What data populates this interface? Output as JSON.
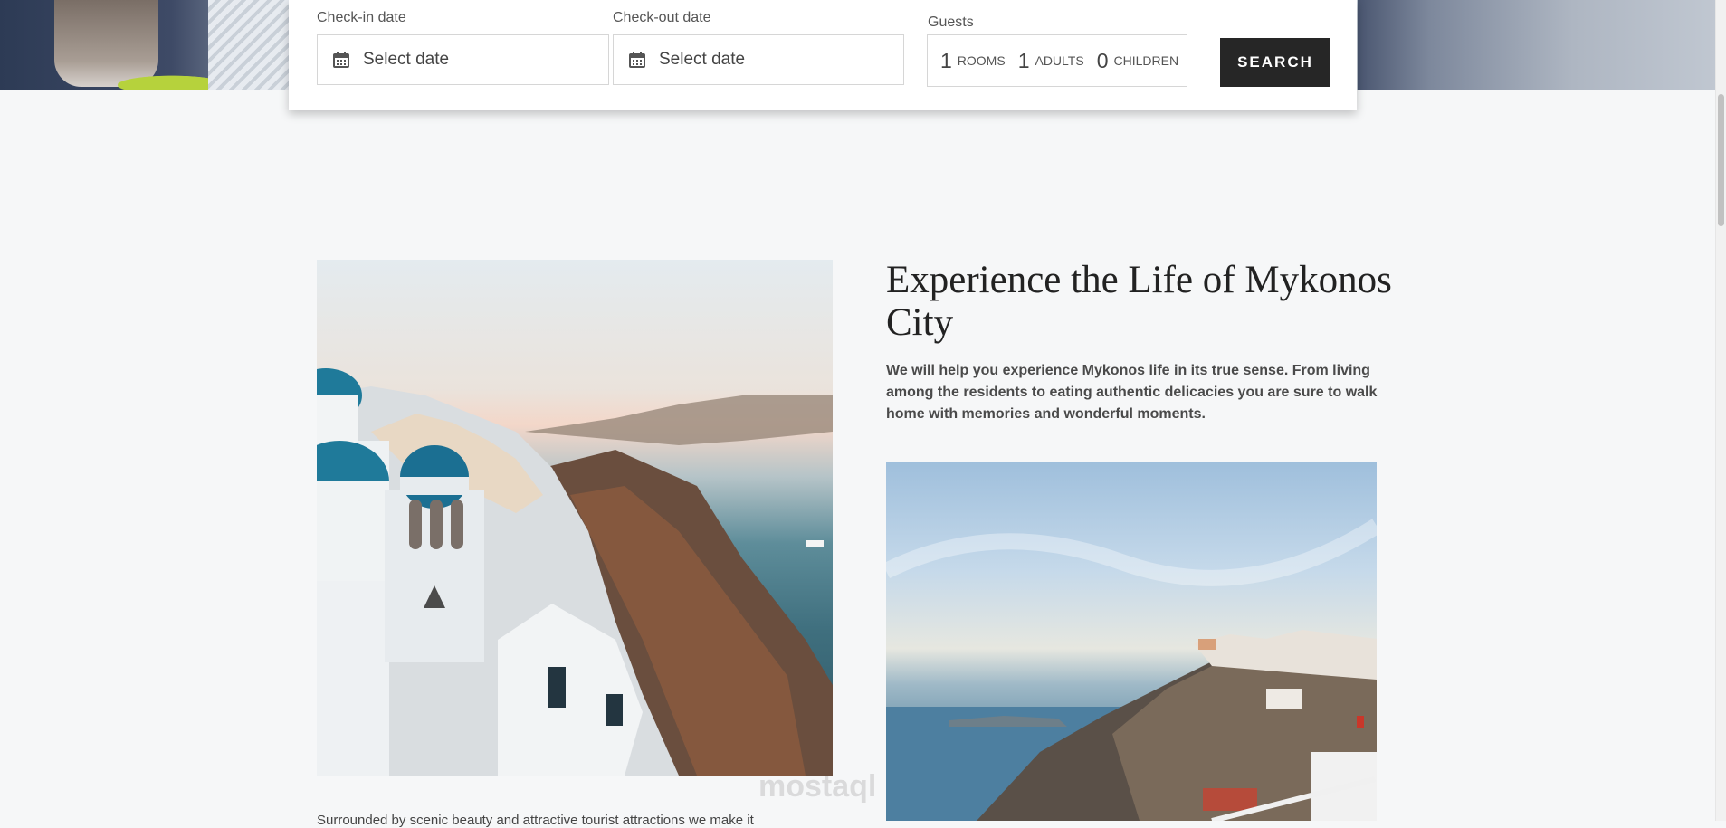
{
  "booking": {
    "checkin_label": "Check-in date",
    "checkin_value": "Select date",
    "checkout_label": "Check-out date",
    "checkout_value": "Select date",
    "guests_label": "Guests",
    "rooms_count": "1",
    "rooms_label": "ROOMS",
    "adults_count": "1",
    "adults_label": "ADULTS",
    "children_count": "0",
    "children_label": "CHILDREN",
    "search_label": "SEARCH"
  },
  "intro": {
    "heading": "Experience the Life of Mykonos City",
    "description": "We will help you experience Mykonos life in its true sense. From living among the residents to eating authentic delicacies you are sure to walk home with memories and wonderful moments.",
    "partial_text": "Surrounded by scenic beauty and attractive tourist attractions we make it"
  },
  "watermark": "mostaql",
  "colors": {
    "page_bg": "#f6f7f8",
    "button_bg": "#262626",
    "button_text": "#ffffff",
    "heading_text": "#222222"
  },
  "icons": [
    "calendar-icon"
  ]
}
